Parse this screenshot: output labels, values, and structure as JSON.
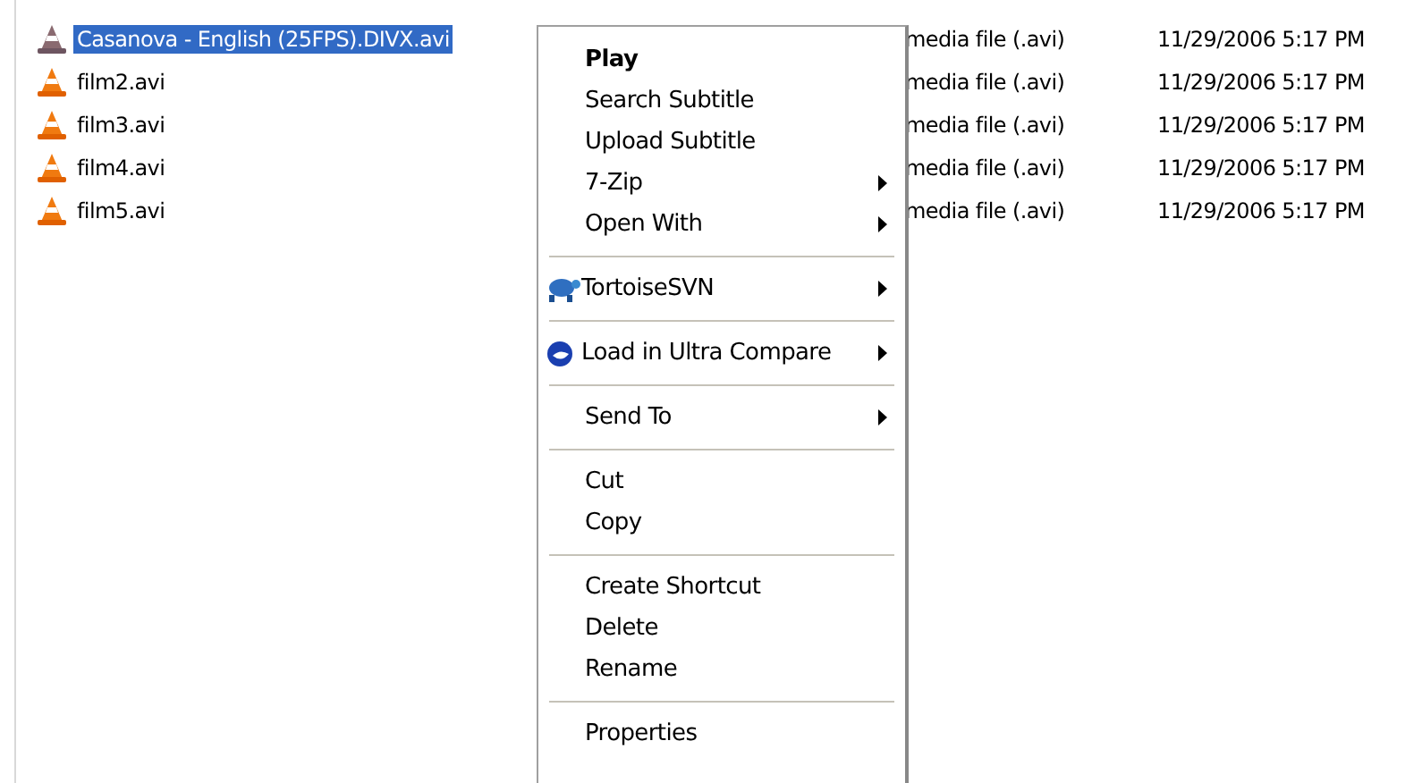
{
  "files": [
    {
      "name": "Casanova - English (25FPS).DIVX.avi",
      "type": "media file (.avi)",
      "modified": "11/29/2006 5:17 PM",
      "selected": true
    },
    {
      "name": "film2.avi",
      "type": "media file (.avi)",
      "modified": "11/29/2006 5:17 PM",
      "selected": false
    },
    {
      "name": "film3.avi",
      "type": "media file (.avi)",
      "modified": "11/29/2006 5:17 PM",
      "selected": false
    },
    {
      "name": "film4.avi",
      "type": "media file (.avi)",
      "modified": "11/29/2006 5:17 PM",
      "selected": false
    },
    {
      "name": "film5.avi",
      "type": "media file (.avi)",
      "modified": "11/29/2006 5:17 PM",
      "selected": false
    }
  ],
  "context_menu": {
    "items": [
      {
        "kind": "item",
        "label": "Play",
        "default": true,
        "submenu": false
      },
      {
        "kind": "item",
        "label": "Search Subtitle",
        "default": false,
        "submenu": false
      },
      {
        "kind": "item",
        "label": "Upload Subtitle",
        "default": false,
        "submenu": false
      },
      {
        "kind": "item",
        "label": "7-Zip",
        "default": false,
        "submenu": true
      },
      {
        "kind": "item",
        "label": "Open With",
        "default": false,
        "submenu": true
      },
      {
        "kind": "separator"
      },
      {
        "kind": "icon_item",
        "label": "TortoiseSVN",
        "default": false,
        "submenu": true
      },
      {
        "kind": "separator"
      },
      {
        "kind": "icon_item",
        "label": "Load in Ultra Compare",
        "default": false,
        "submenu": true
      },
      {
        "kind": "separator"
      },
      {
        "kind": "item",
        "label": "Send To",
        "default": false,
        "submenu": true
      },
      {
        "kind": "separator"
      },
      {
        "kind": "item",
        "label": "Cut",
        "default": false,
        "submenu": false
      },
      {
        "kind": "item",
        "label": "Copy",
        "default": false,
        "submenu": false
      },
      {
        "kind": "separator"
      },
      {
        "kind": "item",
        "label": "Create Shortcut",
        "default": false,
        "submenu": false
      },
      {
        "kind": "item",
        "label": "Delete",
        "default": false,
        "submenu": false
      },
      {
        "kind": "item",
        "label": "Rename",
        "default": false,
        "submenu": false
      },
      {
        "kind": "separator"
      },
      {
        "kind": "item",
        "label": "Properties",
        "default": false,
        "submenu": false
      }
    ]
  }
}
